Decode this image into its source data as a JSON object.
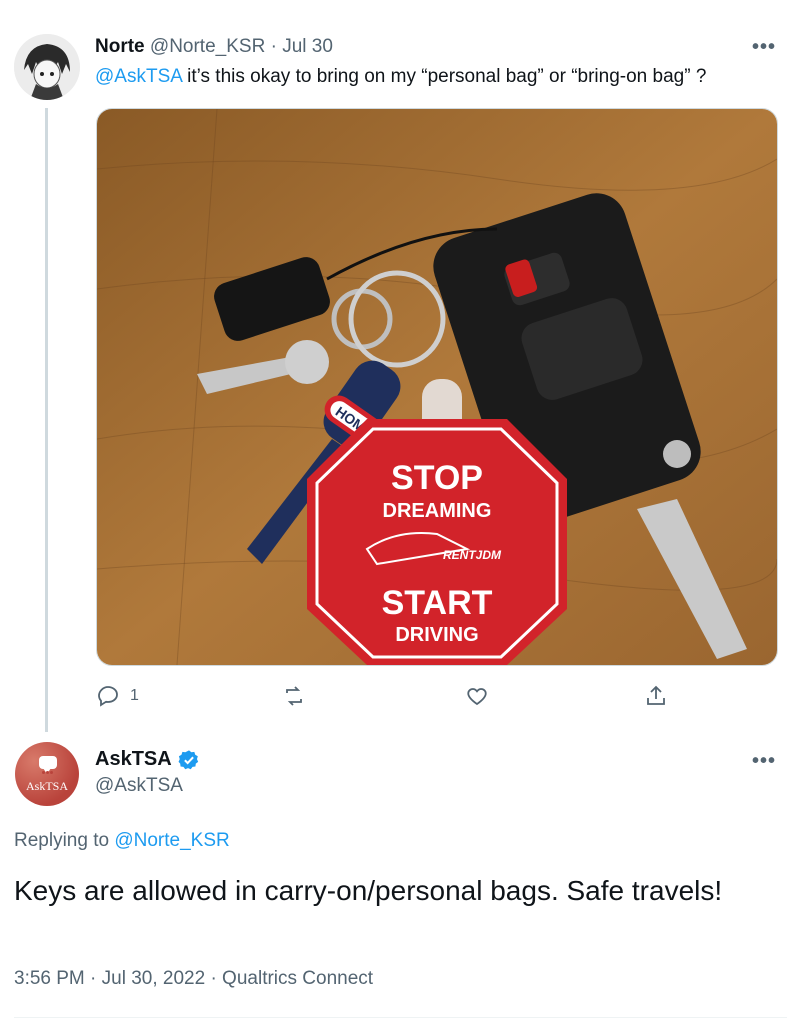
{
  "tweet": {
    "author_name": "Norte",
    "author_handle": "@Norte_KSR",
    "date": "Jul 30",
    "mention": "@AskTSA",
    "text": " it’s this okay to bring on my “personal bag” or “bring-on bag” ?",
    "more_label": "•••",
    "image": {
      "sign_line1": "STOP",
      "sign_line2": "DREAMING",
      "sign_line3": "START",
      "sign_line4": "DRIVING",
      "key_tag": "HOME",
      "brand": "RENTJDM"
    },
    "actions": {
      "reply_count": "1",
      "retweet_count": "",
      "like_count": "",
      "share_count": ""
    }
  },
  "reply": {
    "author_name": "AskTSA",
    "author_handle": "@AskTSA",
    "avatar_text": "AskTSA",
    "more_label": "•••",
    "replying_prefix": "Replying to ",
    "replying_to": "@Norte_KSR",
    "text": "Keys are allowed in carry-on/personal bags. Safe travels!",
    "timestamp": "3:56 PM · Jul 30, 2022 · Qualtrics Connect"
  },
  "colors": {
    "accent": "#1d9bf0",
    "muted": "#536471",
    "verified": "#1d9bf0",
    "sign_red": "#d2232a"
  }
}
